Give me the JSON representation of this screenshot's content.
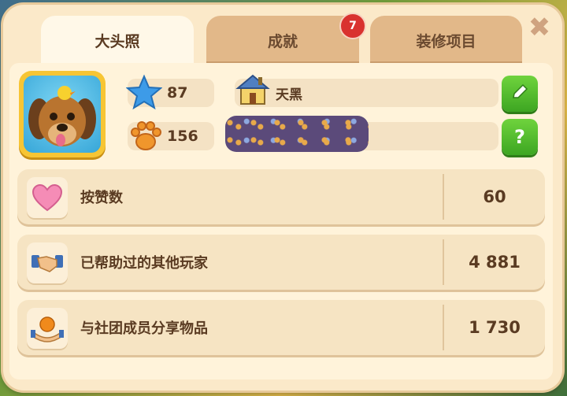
{
  "tabs": [
    {
      "label": "大头照",
      "active": true
    },
    {
      "label": "成就",
      "active": false,
      "badge": "7"
    },
    {
      "label": "装修项目",
      "active": false
    }
  ],
  "close_icon": "close-icon",
  "profile": {
    "stars": "87",
    "paws": "156",
    "town_name": "天黑",
    "name_redacted": true
  },
  "stats": [
    {
      "icon": "heart-icon",
      "label": "按赞数",
      "value": "60"
    },
    {
      "icon": "handshake-icon",
      "label": "已帮助过的其他玩家",
      "value": "4 881"
    },
    {
      "icon": "gift-hands-icon",
      "label": "与社团成员分享物品",
      "value": "1 730"
    }
  ],
  "colors": {
    "panel": "#fbe9c9",
    "green_button": "#4cb82c",
    "badge": "#d9322f",
    "text": "#5a3b22"
  }
}
